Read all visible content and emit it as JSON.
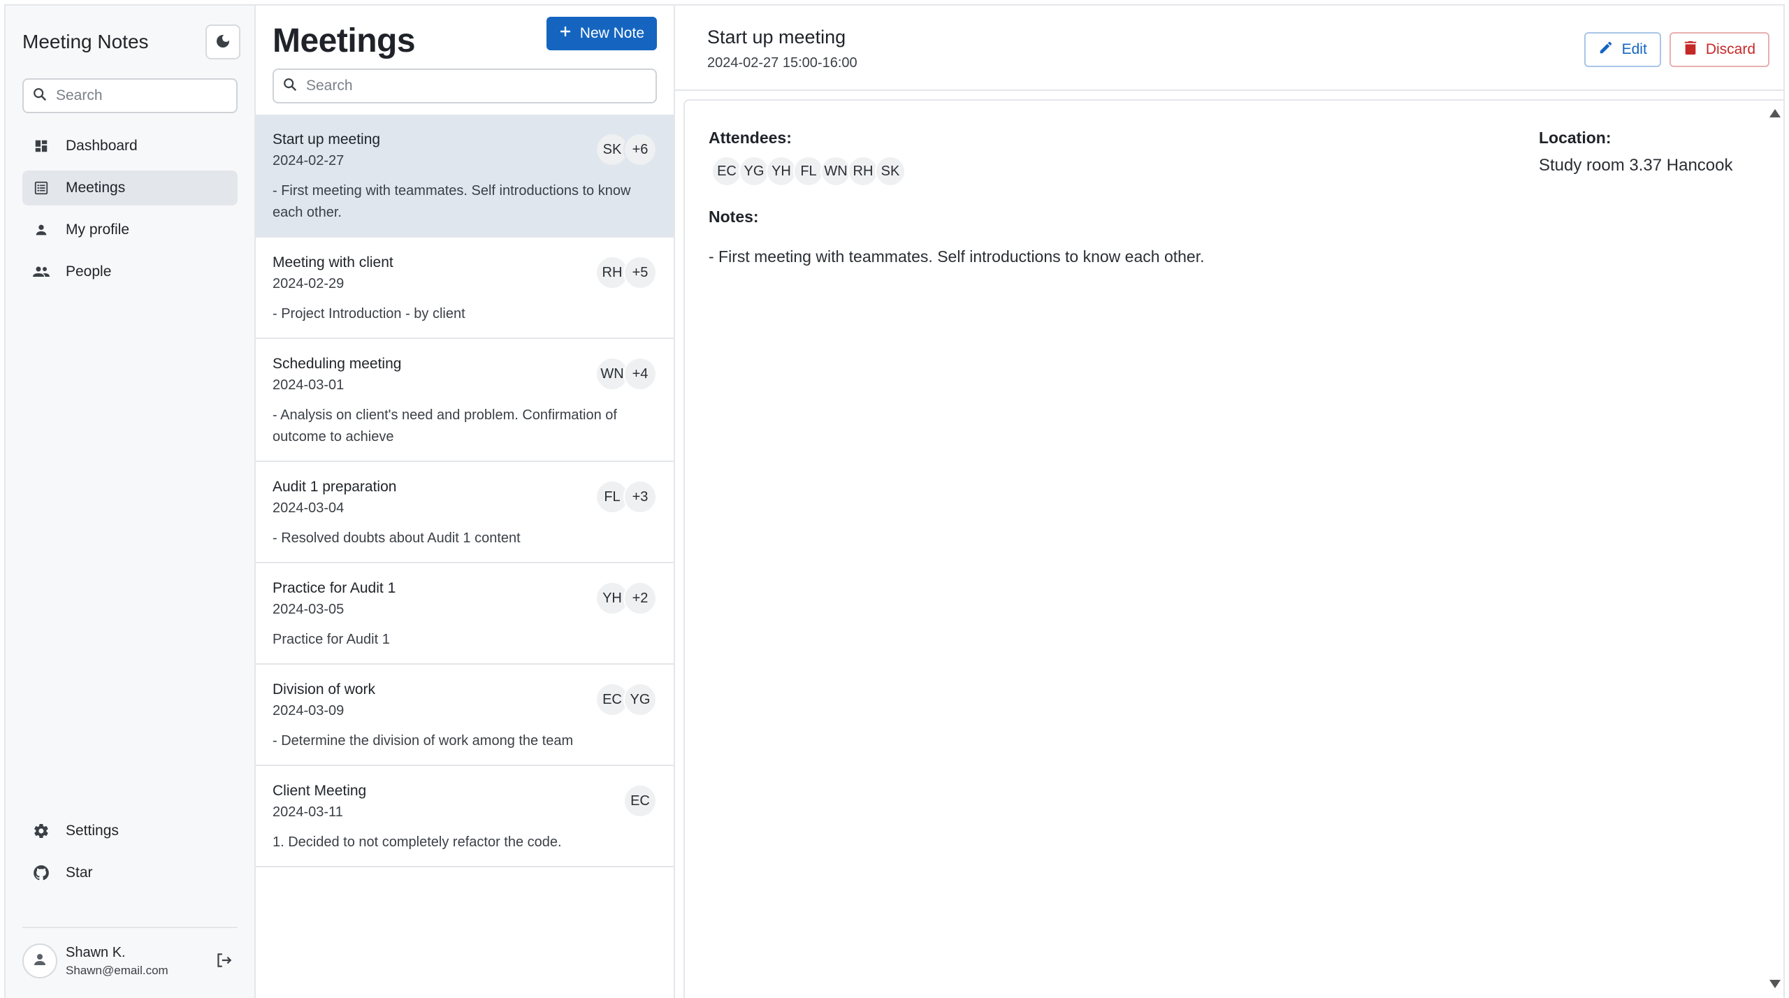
{
  "sidebar": {
    "app_title": "Meeting Notes",
    "search_placeholder": "Search",
    "nav": [
      {
        "label": "Dashboard",
        "icon": "dashboard-icon"
      },
      {
        "label": "Meetings",
        "icon": "list-icon",
        "active": true
      },
      {
        "label": "My profile",
        "icon": "person-icon"
      },
      {
        "label": "People",
        "icon": "people-icon"
      }
    ],
    "bottom": [
      {
        "label": "Settings",
        "icon": "gear-icon"
      },
      {
        "label": "Star",
        "icon": "github-icon"
      }
    ],
    "user": {
      "name": "Shawn K.",
      "email": "Shawn@email.com"
    }
  },
  "list": {
    "title": "Meetings",
    "new_note_label": "New Note",
    "search_placeholder": "Search",
    "meetings": [
      {
        "title": "Start up meeting",
        "date": "2024-02-27",
        "desc": "- First meeting with teammates. Self introductions to know each other.",
        "chips": [
          "SK",
          "+6"
        ],
        "active": true
      },
      {
        "title": "Meeting with client",
        "date": "2024-02-29",
        "desc": "- Project Introduction - by client",
        "chips": [
          "RH",
          "+5"
        ]
      },
      {
        "title": "Scheduling meeting",
        "date": "2024-03-01",
        "desc": "- Analysis on client's need and problem. Confirmation of outcome to achieve",
        "chips": [
          "WN",
          "+4"
        ]
      },
      {
        "title": "Audit 1 preparation",
        "date": "2024-03-04",
        "desc": "- Resolved doubts about Audit 1 content",
        "chips": [
          "FL",
          "+3"
        ]
      },
      {
        "title": "Practice for Audit 1",
        "date": "2024-03-05",
        "desc": "Practice for Audit 1",
        "chips": [
          "YH",
          "+2"
        ]
      },
      {
        "title": "Division of work",
        "date": "2024-03-09",
        "desc": "- Determine the division of work among the team",
        "chips": [
          "EC",
          "YG"
        ]
      },
      {
        "title": "Client Meeting",
        "date": "2024-03-11",
        "desc": "1. Decided to not completely refactor the code.",
        "chips": [
          "EC"
        ]
      }
    ]
  },
  "detail": {
    "title": "Start up meeting",
    "time": "2024-02-27 15:00-16:00",
    "edit_label": "Edit",
    "discard_label": "Discard",
    "attendees_label": "Attendees:",
    "attendees": [
      "EC",
      "YG",
      "YH",
      "FL",
      "WN",
      "RH",
      "SK"
    ],
    "location_label": "Location:",
    "location": "Study room 3.37 Hancook",
    "notes_label": "Notes:",
    "notes": "- First meeting with teammates. Self introductions to know each other."
  },
  "colors": {
    "primary": "#1565c0",
    "danger": "#c62828",
    "active_row": "#dfe6ee",
    "sidebar_bg": "#f7f8f9"
  }
}
